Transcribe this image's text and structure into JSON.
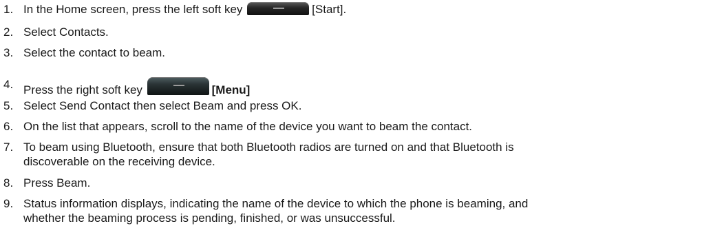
{
  "steps": [
    {
      "num": "1.",
      "text_before": "In the Home screen, press the left soft key",
      "key_icon": "left-soft-key-icon",
      "text_after": "[Start]."
    },
    {
      "num": "2.",
      "text": "Select Contacts."
    },
    {
      "num": "3.",
      "text": "Select the contact to beam."
    },
    {
      "num": "4.",
      "text_before": "Press the right soft key",
      "key_icon": "right-soft-key-icon",
      "text_after": "[Menu]"
    },
    {
      "num": "5.",
      "text": "Select Send Contact then select Beam and press OK."
    },
    {
      "num": "6.",
      "text": "On the list that appears, scroll to the name of the device you want to beam the contact."
    },
    {
      "num": "7.",
      "lines": [
        "To beam using Bluetooth, ensure that both Bluetooth radios are turned on and that Bluetooth is",
        "discoverable on the receiving device."
      ]
    },
    {
      "num": "8.",
      "text": "Press Beam."
    },
    {
      "num": "9.",
      "lines": [
        "Status information displays, indicating the name of the device to which the phone is beaming, and",
        "whether the beaming process is pending, finished, or was unsuccessful."
      ]
    }
  ]
}
